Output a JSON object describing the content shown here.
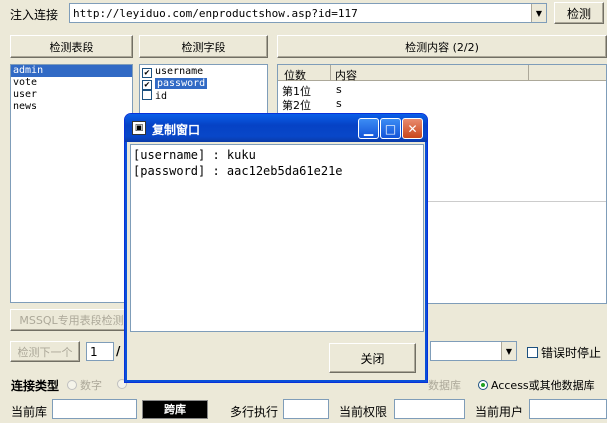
{
  "toolbar": {
    "inject_label": "注入连接",
    "url_value": "http://leyiduo.com/enproductshow.asp?id=117",
    "detect_button": "检测"
  },
  "panels": {
    "tables_button": "检测表段",
    "fields_button": "检测字段",
    "content_header": "检测内容 (2/2)"
  },
  "tables": [
    "admin",
    "vote",
    "user",
    "news"
  ],
  "fields": [
    {
      "name": "username",
      "checked": true,
      "selected": false
    },
    {
      "name": "password",
      "checked": true,
      "selected": true
    },
    {
      "name": "id",
      "checked": false,
      "selected": false
    }
  ],
  "content_table": {
    "headers": [
      "位数",
      "内容"
    ],
    "rows": [
      {
        "pos": "第1位",
        "val": "s"
      },
      {
        "pos": "第2位",
        "val": "s"
      }
    ]
  },
  "mssql_button": "MSSQL专用表段检测",
  "next_button": "检测下一个",
  "page_value": "1",
  "page_sep": "/",
  "error_stop_label": "错误时停止",
  "conn_type": {
    "label": "连接类型",
    "option_number": "数字",
    "option_other_db": "数据库",
    "option_access": "Access或其他数据库"
  },
  "bottom": {
    "current_db_label": "当前库",
    "cross_db_button": "跨库",
    "multi_exec_label": "多行执行",
    "current_priv_label": "当前权限",
    "current_user_label": "当前用户"
  },
  "dialog": {
    "title": "复制窗口",
    "lines": [
      "[username] : kuku",
      "[password] : aac12eb5da61e21e"
    ],
    "close_button": "关闭"
  }
}
